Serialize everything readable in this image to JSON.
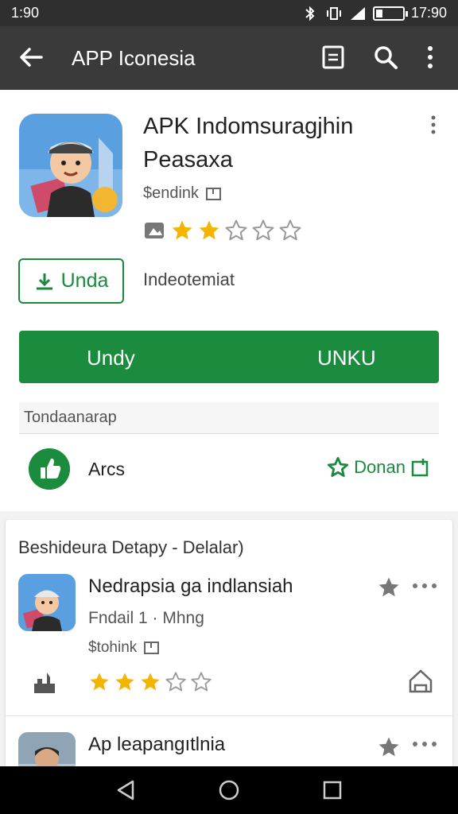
{
  "status_bar": {
    "time_left": "1:90",
    "time_right": "17:90",
    "battery_level": 0.25
  },
  "toolbar": {
    "title": "APP Iconesia"
  },
  "app": {
    "name_line1": "APK Indomsuragjhin",
    "name_line2": "Peasaxa",
    "developer": "$endink",
    "rating": 2,
    "rating_max": 5,
    "install_small_label": "Unda",
    "meta_text": "Indeotemiat",
    "primary_left_label": "Undy",
    "primary_right_label": "UNKU"
  },
  "section": {
    "label": "Tondaanarap"
  },
  "like": {
    "label": "Arcs",
    "donate_label": "Donan"
  },
  "list": {
    "title": "Beshideura Detapy  - Delalar)",
    "items": [
      {
        "name": "Nedrapsia ga indlansiah",
        "subtitle": "Fndail 1 · Mhng",
        "developer": "$tohink",
        "rating": 3,
        "rating_max": 5
      },
      {
        "name": "Ap leapangıtlnia"
      }
    ]
  },
  "colors": {
    "accent": "#1b8c3d",
    "toolbar": "#3a3a3a",
    "status_bar": "#2f2f2f",
    "star": "#f4b400",
    "nav": "#000000"
  }
}
